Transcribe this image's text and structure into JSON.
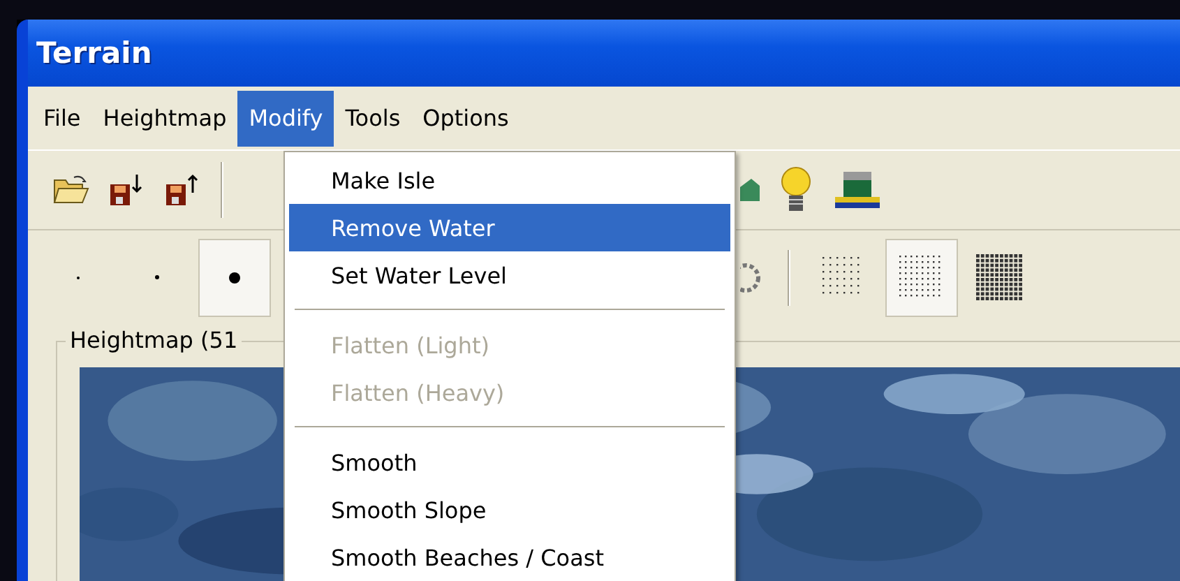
{
  "window": {
    "title": "Terrain"
  },
  "menu_bar": [
    {
      "label": "File",
      "selected": false
    },
    {
      "label": "Heightmap",
      "selected": false
    },
    {
      "label": "Modify",
      "selected": true
    },
    {
      "label": "Tools",
      "selected": false
    },
    {
      "label": "Options",
      "selected": false
    }
  ],
  "brush_buttons": [
    {
      "kind": "tiny",
      "pressed": false
    },
    {
      "kind": "small",
      "pressed": false
    },
    {
      "kind": "dot",
      "pressed": true
    }
  ],
  "pattern_buttons": [
    {
      "kind": "sparse",
      "pressed": false
    },
    {
      "kind": "medium",
      "pressed": true
    },
    {
      "kind": "dense",
      "pressed": false
    }
  ],
  "group": {
    "label": "Heightmap (51"
  },
  "dropdown": [
    {
      "kind": "item",
      "label": "Make Isle",
      "selected": false,
      "disabled": false
    },
    {
      "kind": "item",
      "label": "Remove Water",
      "selected": true,
      "disabled": false
    },
    {
      "kind": "item",
      "label": "Set Water Level",
      "selected": false,
      "disabled": false
    },
    {
      "kind": "separator"
    },
    {
      "kind": "item",
      "label": "Flatten (Light)",
      "selected": false,
      "disabled": true
    },
    {
      "kind": "item",
      "label": "Flatten (Heavy)",
      "selected": false,
      "disabled": true
    },
    {
      "kind": "separator"
    },
    {
      "kind": "item",
      "label": "Smooth",
      "selected": false,
      "disabled": false
    },
    {
      "kind": "item",
      "label": "Smooth Slope",
      "selected": false,
      "disabled": false
    },
    {
      "kind": "item",
      "label": "Smooth Beaches / Coast",
      "selected": false,
      "disabled": false
    }
  ]
}
